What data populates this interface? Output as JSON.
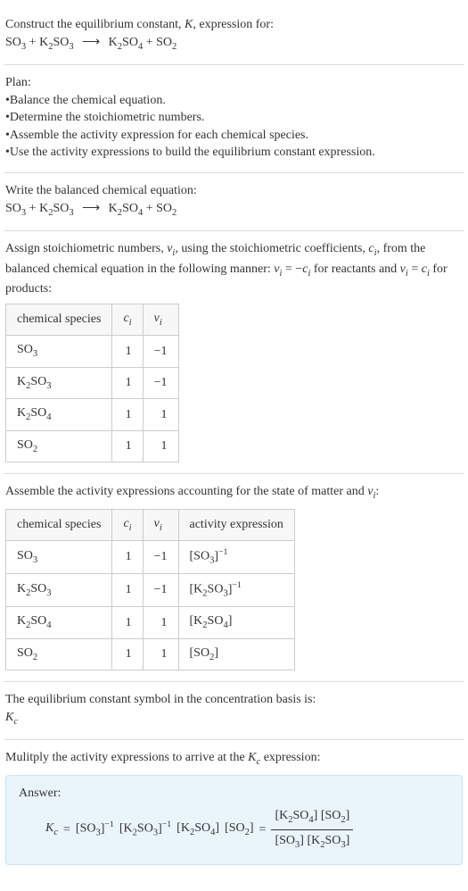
{
  "header": {
    "prompt_prefix": "Construct the equilibrium constant, ",
    "K": "K",
    "prompt_suffix": ", expression for:"
  },
  "equation": {
    "reactant1": {
      "base": "SO",
      "sub": "3"
    },
    "reactant2": {
      "base": "K",
      "sub1": "2",
      "mid": "SO",
      "sub2": "3"
    },
    "product1": {
      "base": "K",
      "sub1": "2",
      "mid": "SO",
      "sub2": "4"
    },
    "product2": {
      "base": "SO",
      "sub": "2"
    },
    "plus": " + ",
    "arrow": "⟶"
  },
  "plan": {
    "title": "Plan:",
    "items": [
      "Balance the chemical equation.",
      "Determine the stoichiometric numbers.",
      "Assemble the activity expression for each chemical species.",
      "Use the activity expressions to build the equilibrium constant expression."
    ]
  },
  "balanced": {
    "title": "Write the balanced chemical equation:"
  },
  "assign": {
    "line1a": "Assign stoichiometric numbers, ",
    "nu": "ν",
    "sub_i": "i",
    "line1b": ", using the stoichiometric coefficients, ",
    "c": "c",
    "line1c": ", from ",
    "line2": "the balanced chemical equation in the following manner: ",
    "eqn_for_react": " for reactants ",
    "line3": "and ",
    "eqn_for_prod": " for products:",
    "eq": " = ",
    "minus": "−"
  },
  "table1": {
    "headers": {
      "species": "chemical species",
      "c": "c",
      "c_sub": "i",
      "nu": "ν",
      "nu_sub": "i"
    },
    "rows": [
      {
        "species_html": "SO3",
        "c": "1",
        "nu": "−1"
      },
      {
        "species_html": "K2SO3",
        "c": "1",
        "nu": "−1"
      },
      {
        "species_html": "K2SO4",
        "c": "1",
        "nu": "1"
      },
      {
        "species_html": "SO2",
        "c": "1",
        "nu": "1"
      }
    ]
  },
  "assemble": {
    "line1a": "Assemble the activity expressions accounting for the state of matter and ",
    "colon": ":"
  },
  "table2": {
    "headers": {
      "activity": "activity expression"
    },
    "rows": [
      {
        "species": "SO3",
        "c": "1",
        "nu": "−1",
        "expr": "[SO3]^-1"
      },
      {
        "species": "K2SO3",
        "c": "1",
        "nu": "−1",
        "expr": "[K2SO3]^-1"
      },
      {
        "species": "K2SO4",
        "c": "1",
        "nu": "1",
        "expr": "[K2SO4]"
      },
      {
        "species": "SO2",
        "c": "1",
        "nu": "1",
        "expr": "[SO2]"
      }
    ]
  },
  "kc_line1": "The equilibrium constant symbol in the concentration basis is:",
  "kc_symbol": "K",
  "kc_sub": "c",
  "multiply_line": "Mulitply the activity expressions to arrive at the ",
  "multiply_suffix": " expression:",
  "answer_label": "Answer:",
  "final": {
    "eq": " = ",
    "lbr": "[",
    "rbr": "]"
  },
  "chart_data": {
    "type": "table",
    "title": "Stoichiometric numbers and activity expressions",
    "columns": [
      "chemical species",
      "c_i",
      "nu_i",
      "activity expression"
    ],
    "rows": [
      {
        "chemical species": "SO3",
        "c_i": 1,
        "nu_i": -1,
        "activity expression": "[SO3]^-1"
      },
      {
        "chemical species": "K2SO3",
        "c_i": 1,
        "nu_i": -1,
        "activity expression": "[K2SO3]^-1"
      },
      {
        "chemical species": "K2SO4",
        "c_i": 1,
        "nu_i": 1,
        "activity expression": "[K2SO4]"
      },
      {
        "chemical species": "SO2",
        "c_i": 1,
        "nu_i": 1,
        "activity expression": "[SO2]"
      }
    ],
    "equilibrium_constant": "Kc = ([K2SO4][SO2]) / ([SO3][K2SO3])"
  }
}
